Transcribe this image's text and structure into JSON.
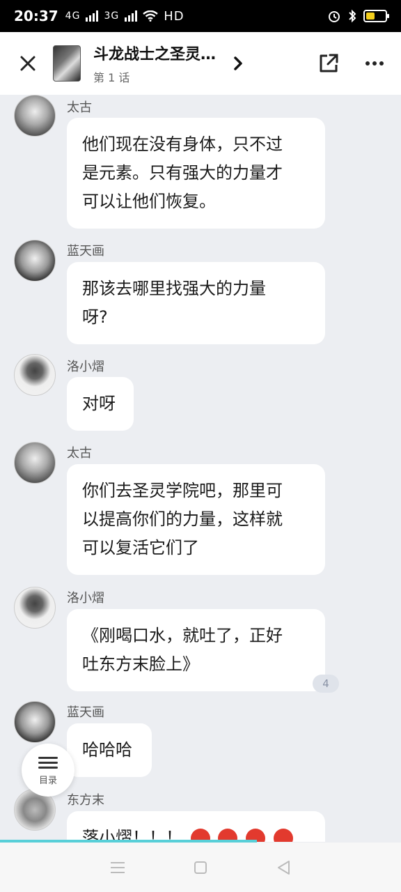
{
  "status_bar": {
    "time": "20:37",
    "network_1": "4G",
    "network_2": "3G",
    "wifi_label": "HD"
  },
  "header": {
    "title": "斗龙战士之圣灵…",
    "subtitle": "第 1 话"
  },
  "messages": [
    {
      "name": "太古",
      "text_lines": [
        "他们现在没有身体，只不过",
        "是元素。只有强大的力量才",
        "可以让他们恢复。"
      ],
      "avatar": "taigu"
    },
    {
      "name": "蓝天画",
      "text_lines": [
        "那该去哪里找强大的力量",
        "呀?"
      ],
      "avatar": "lantianhua"
    },
    {
      "name": "洛小熠",
      "text_lines": [
        "对呀"
      ],
      "avatar": "luoxiaoyi"
    },
    {
      "name": "太古",
      "text_lines": [
        "你们去圣灵学院吧，那里可",
        "以提高你们的力量，这样就",
        "可以复活它们了"
      ],
      "avatar": "taigu"
    },
    {
      "name": "洛小熠",
      "text_lines": [
        "《刚喝口水，就吐了，正好",
        "吐东方末脸上》"
      ],
      "avatar": "luoxiaoyi",
      "comment_count": "4"
    },
    {
      "name": "蓝天画",
      "text_lines": [
        "哈哈哈"
      ],
      "avatar": "lantianhua"
    },
    {
      "name": "东方末",
      "text_lines": [
        "落小熠！！！"
      ],
      "avatar": "dongfangmo"
    }
  ],
  "toc": {
    "label": "目录"
  },
  "reading_progress": 0.64,
  "colors": {
    "accent": "#58cfd8",
    "background": "#eceef2",
    "bubble": "#ffffff"
  }
}
